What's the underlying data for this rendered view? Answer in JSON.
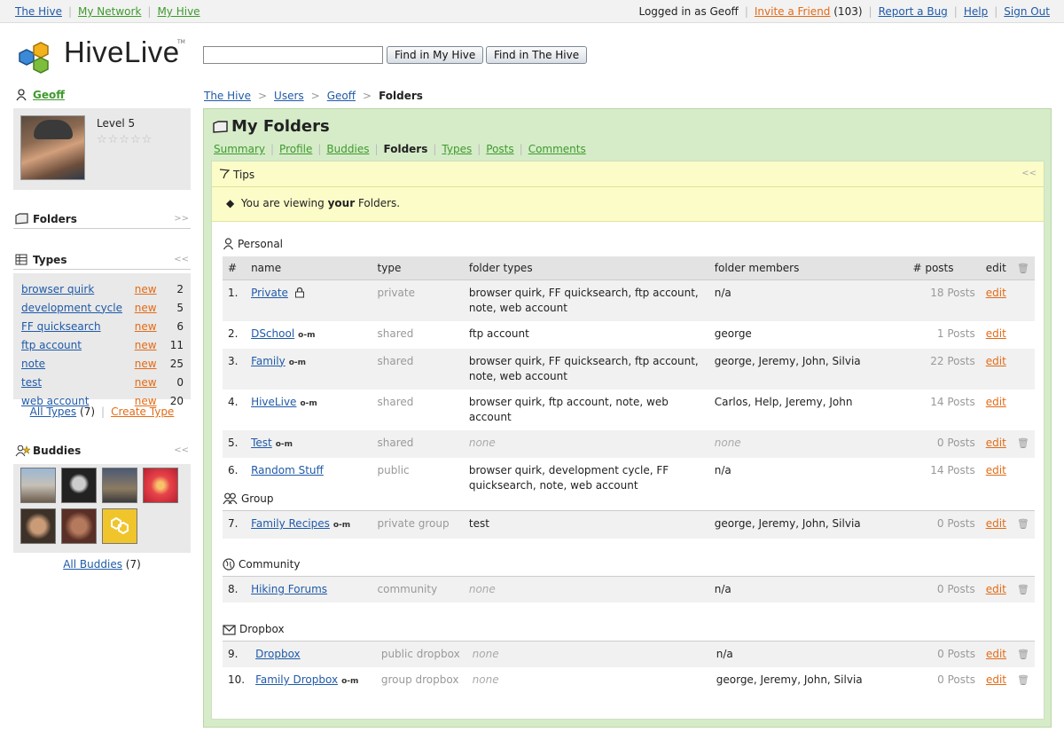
{
  "topbar": {
    "left_links": [
      "The Hive",
      "My Network",
      "My Hive"
    ],
    "logged_in": "Logged in as Geoff",
    "invite": "Invite a Friend",
    "invite_count": "(103)",
    "report": "Report a Bug",
    "help": "Help",
    "signout": "Sign Out"
  },
  "header": {
    "logo": "HiveLive",
    "tm": "TM",
    "search_value": "",
    "find_my": "Find in My Hive",
    "find_hive": "Find in The Hive"
  },
  "sidebar": {
    "user": "Geoff",
    "level": "Level 5",
    "stars": "☆☆☆☆☆",
    "folders_label": "Folders",
    "folders_chev": ">>",
    "types_label": "Types",
    "types_chev": "<<",
    "types": [
      {
        "name": "browser quirk",
        "new": "new",
        "count": "2"
      },
      {
        "name": "development cycle",
        "new": "new",
        "count": "5"
      },
      {
        "name": "FF quicksearch",
        "new": "new",
        "count": "6"
      },
      {
        "name": "ftp account",
        "new": "new",
        "count": "11"
      },
      {
        "name": "note",
        "new": "new",
        "count": "25"
      },
      {
        "name": "test",
        "new": "new",
        "count": "0"
      },
      {
        "name": "web account",
        "new": "new",
        "count": "20"
      }
    ],
    "all_types": "All Types",
    "all_types_count": "(7)",
    "create_type": "Create Type",
    "buddies_label": "Buddies",
    "buddies_chev": "<<",
    "all_buddies": "All Buddies",
    "all_buddies_count": "(7)"
  },
  "breadcrumb": {
    "items": [
      "The Hive",
      "Users",
      "Geoff"
    ],
    "current": "Folders"
  },
  "main": {
    "title": "My Folders",
    "tabs": [
      "Summary",
      "Profile",
      "Buddies",
      "Folders",
      "Types",
      "Posts",
      "Comments"
    ],
    "tips_title": "Tips",
    "tips_chev": "<<",
    "tips_msg_pre": "You are viewing ",
    "tips_msg_bold": "your",
    "tips_msg_post": " Folders.",
    "columns": [
      "#",
      "name",
      "type",
      "folder types",
      "folder members",
      "# posts",
      "edit"
    ],
    "sections": {
      "personal": "Personal",
      "group": "Group",
      "community": "Community",
      "dropbox": "Dropbox"
    },
    "rows": [
      {
        "num": "1.",
        "name": "Private",
        "type": "private",
        "ftypes": "browser quirk, FF quicksearch, ftp account, note, web account",
        "members": "n/a",
        "posts": "18 Posts",
        "edit": "edit"
      },
      {
        "num": "2.",
        "name": "DSchool",
        "type": "shared",
        "ftypes": "ftp account",
        "members": "george",
        "posts": "1 Posts",
        "edit": "edit"
      },
      {
        "num": "3.",
        "name": "Family",
        "type": "shared",
        "ftypes": "browser quirk, FF quicksearch, ftp account, note, web account",
        "members": "george, Jeremy, John, Silvia",
        "posts": "22 Posts",
        "edit": "edit"
      },
      {
        "num": "4.",
        "name": "HiveLive",
        "type": "shared",
        "ftypes": "browser quirk, ftp account, note, web account",
        "members": "Carlos, Help, Jeremy, John",
        "posts": "14 Posts",
        "edit": "edit"
      },
      {
        "num": "5.",
        "name": "Test",
        "type": "shared",
        "ftypes": "none",
        "members": "none",
        "posts": "0 Posts",
        "edit": "edit"
      },
      {
        "num": "6.",
        "name": "Random Stuff",
        "type": "public",
        "ftypes": "browser quirk, development cycle, FF quicksearch, note, web account",
        "members": "n/a",
        "posts": "14 Posts",
        "edit": "edit"
      },
      {
        "num": "7.",
        "name": "Family Recipes",
        "type": "private group",
        "ftypes": "test",
        "members": "george, Jeremy, John, Silvia",
        "posts": "0 Posts",
        "edit": "edit"
      },
      {
        "num": "8.",
        "name": "Hiking Forums",
        "type": "community",
        "ftypes": "none",
        "members": "n/a",
        "posts": "0 Posts",
        "edit": "edit"
      },
      {
        "num": "9.",
        "name": "Dropbox",
        "type": "public dropbox",
        "ftypes": "none",
        "members": "n/a",
        "posts": "0 Posts",
        "edit": "edit"
      },
      {
        "num": "10.",
        "name": "Family Dropbox",
        "type": "group dropbox",
        "ftypes": "none",
        "members": "george, Jeremy, John, Silvia",
        "posts": "0 Posts",
        "edit": "edit"
      }
    ]
  },
  "colors": {
    "link": "#1f5aa8",
    "green": "#3f9a2d",
    "orange": "#e36b16",
    "panel": "#d6ecc9",
    "tips": "#fbfcc8"
  }
}
